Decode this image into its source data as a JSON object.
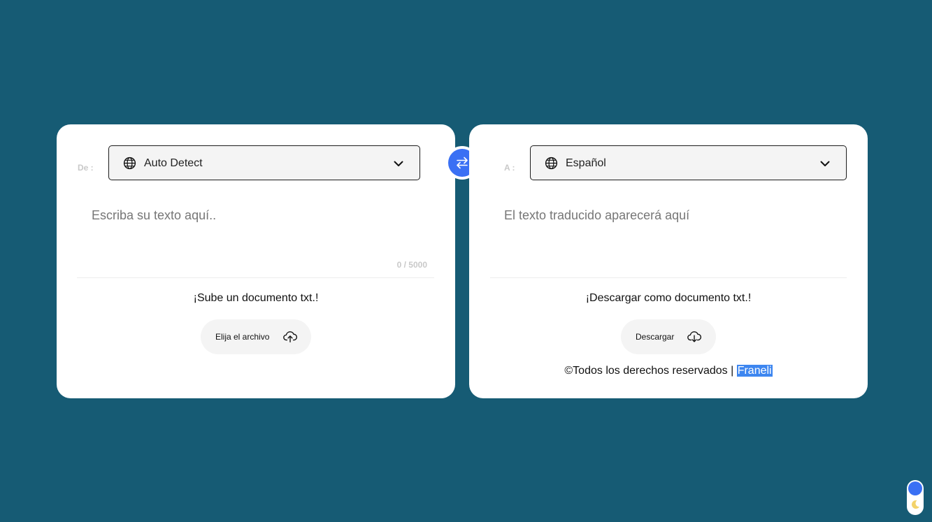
{
  "source": {
    "label": "De :",
    "language": "Auto Detect",
    "globe_icon": "globe-icon",
    "dropdown_icon": "chevron-down-icon",
    "placeholder": "Escriba su texto aquí..",
    "char_count": "0 / 5000",
    "upload_caption": "¡Sube un documento txt.!",
    "upload_button": "Elija el archivo",
    "upload_icon": "cloud-upload-icon"
  },
  "target": {
    "label": "A :",
    "language": "Español",
    "globe_icon": "globe-icon",
    "dropdown_icon": "chevron-down-icon",
    "placeholder": "El texto traducido aparecerá aquí",
    "download_caption": "¡Descargar como documento txt.!",
    "download_button": "Descargar",
    "download_icon": "cloud-download-icon"
  },
  "swap": {
    "icon": "swap-arrows-icon",
    "color": "#3a70f4"
  },
  "footer": {
    "copyright": "©Todos los derechos reservados | ",
    "author": "Franeli"
  },
  "theme_toggle": {
    "knob_color": "#3a70f4",
    "icon": "moon-icon"
  },
  "colors": {
    "background": "#165b74",
    "card": "#ffffff",
    "accent": "#3a70f4",
    "highlight": "#3d86f0"
  }
}
